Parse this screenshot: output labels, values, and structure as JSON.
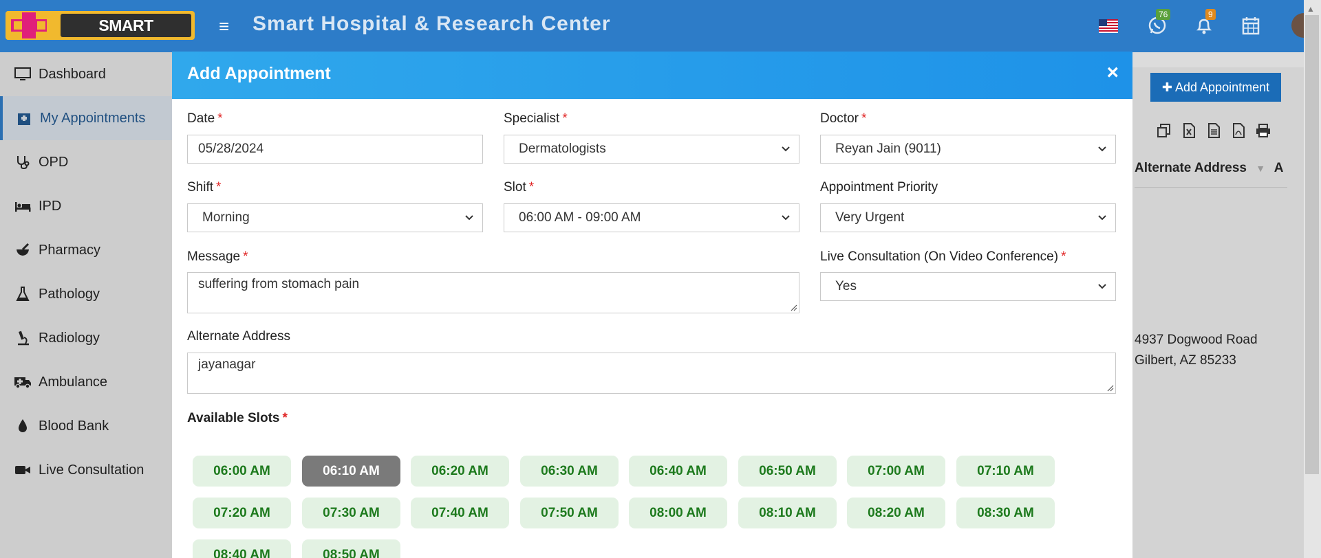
{
  "header": {
    "logo_text": "SMART HOSPITAL",
    "site_title": "Smart Hospital & Research Center",
    "whatsapp_count": "76",
    "notification_count": "9"
  },
  "sidebar": {
    "items": [
      {
        "label": "Dashboard",
        "icon": "monitor-icon"
      },
      {
        "label": "My Appointments",
        "icon": "hospital-building-icon",
        "active": true
      },
      {
        "label": "OPD",
        "icon": "stethoscope-icon"
      },
      {
        "label": "IPD",
        "icon": "bed-icon"
      },
      {
        "label": "Pharmacy",
        "icon": "mortar-pestle-icon"
      },
      {
        "label": "Pathology",
        "icon": "flask-icon"
      },
      {
        "label": "Radiology",
        "icon": "microscope-icon"
      },
      {
        "label": "Ambulance",
        "icon": "ambulance-icon"
      },
      {
        "label": "Blood Bank",
        "icon": "blood-drop-icon"
      },
      {
        "label": "Live Consultation",
        "icon": "video-camera-icon"
      }
    ]
  },
  "background_page": {
    "add_button": "Add Appointment",
    "column_header": "Alternate Address",
    "column_header_next": "A",
    "address_line1": "4937 Dogwood Road",
    "address_line2": "Gilbert, AZ 85233"
  },
  "modal": {
    "title": "Add Appointment",
    "close": "×",
    "required_mark": "*",
    "date": {
      "label": "Date",
      "value": "05/28/2024"
    },
    "specialist": {
      "label": "Specialist",
      "value": "Dermatologists"
    },
    "doctor": {
      "label": "Doctor",
      "value": "Reyan Jain (9011)"
    },
    "shift": {
      "label": "Shift",
      "value": "Morning"
    },
    "slot": {
      "label": "Slot",
      "value": "06:00 AM - 09:00 AM"
    },
    "priority": {
      "label": "Appointment Priority",
      "value": "Very Urgent"
    },
    "message": {
      "label": "Message",
      "value": "suffering from stomach pain"
    },
    "live_consultation": {
      "label": "Live Consultation (On Video Conference)",
      "value": "Yes"
    },
    "alternate_address": {
      "label": "Alternate Address",
      "value": "jayanagar"
    },
    "available_slots_label": "Available Slots",
    "slots": [
      "06:00 AM",
      "06:10 AM",
      "06:20 AM",
      "06:30 AM",
      "06:40 AM",
      "06:50 AM",
      "07:00 AM",
      "07:10 AM",
      "07:20 AM",
      "07:30 AM",
      "07:40 AM",
      "07:50 AM",
      "08:00 AM",
      "08:10 AM",
      "08:20 AM",
      "08:30 AM",
      "08:40 AM",
      "08:50 AM"
    ],
    "selected_slot": "06:10 AM"
  },
  "colors": {
    "topbar": "#2d7cc8",
    "modal_header": "#1e92e8",
    "slot_bg": "#e3f2e3",
    "slot_text": "#1d7a1d",
    "slot_selected_bg": "#7a7a7a",
    "required": "#e02424"
  }
}
